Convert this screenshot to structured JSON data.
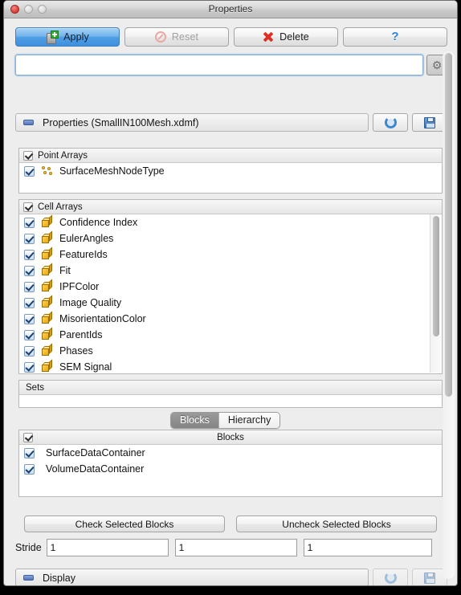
{
  "window": {
    "title": "Properties",
    "controls": [
      "close",
      "minimize",
      "maximize"
    ]
  },
  "toolbar": {
    "apply_label": "Apply",
    "reset_label": "Reset",
    "delete_label": "Delete",
    "help_label": "?"
  },
  "search": {
    "value": "",
    "placeholder": "",
    "gear_tooltip": "Advanced properties"
  },
  "properties_section": {
    "title": "Properties (SmallIN100Mesh.xdmf)",
    "refresh_label": "",
    "save_label": ""
  },
  "point_arrays": {
    "header": "Point Arrays",
    "header_checked": true,
    "items": [
      {
        "label": "SurfaceMeshNodeType",
        "checked": true
      }
    ]
  },
  "cell_arrays": {
    "header": "Cell Arrays",
    "header_checked": true,
    "items": [
      {
        "label": "Confidence Index",
        "checked": true
      },
      {
        "label": "EulerAngles",
        "checked": true
      },
      {
        "label": "FeatureIds",
        "checked": true
      },
      {
        "label": "Fit",
        "checked": true
      },
      {
        "label": "IPFColor",
        "checked": true
      },
      {
        "label": "Image Quality",
        "checked": true
      },
      {
        "label": "MisorientationColor",
        "checked": true
      },
      {
        "label": "ParentIds",
        "checked": true
      },
      {
        "label": "Phases",
        "checked": true
      },
      {
        "label": "SEM Signal",
        "checked": true
      }
    ]
  },
  "sets": {
    "header": "Sets",
    "items": []
  },
  "tabs": {
    "active": "Blocks",
    "items": [
      {
        "label": "Blocks"
      },
      {
        "label": "Hierarchy"
      }
    ]
  },
  "blocks": {
    "header": "Blocks",
    "header_checked": true,
    "items": [
      {
        "label": "SurfaceDataContainer",
        "checked": true
      },
      {
        "label": "VolumeDataContainer",
        "checked": true
      }
    ]
  },
  "block_buttons": {
    "check_label": "Check Selected Blocks",
    "uncheck_label": "Uncheck Selected Blocks"
  },
  "stride": {
    "label": "Stride",
    "values": [
      "1",
      "1",
      "1"
    ]
  },
  "display_section": {
    "title": "Display",
    "refresh_label": "",
    "save_label": ""
  },
  "colors": {
    "accent_blue": "#4f9fe6",
    "panel_bg": "#ededec",
    "list_bg": "#ffffff",
    "icon_yellow": "#e8a715",
    "delete_red": "#dd2f22",
    "help_blue": "#2d82d8"
  }
}
